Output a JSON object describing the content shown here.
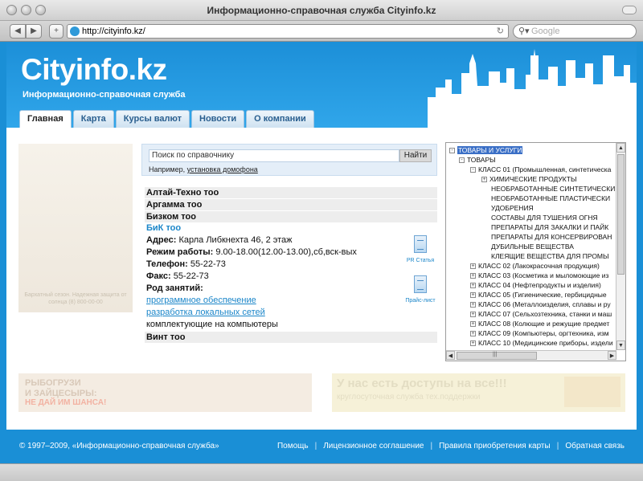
{
  "browser": {
    "title": "Информационно-справочная служба Cityinfo.kz",
    "url": "http://cityinfo.kz/",
    "search_placeholder": "Google"
  },
  "site": {
    "logo": "Cityinfo.kz",
    "tagline": "Информационно-справочная служба",
    "tabs": [
      "Главная",
      "Карта",
      "Курсы валют",
      "Новости",
      "О компании"
    ]
  },
  "ad_left_caption": "Бархатный сезон. Надежная защита от солнца (8) 800-00-00",
  "search": {
    "value": "Поиск по справочнику",
    "button": "Найти",
    "hint_prefix": "Например,",
    "hint_link": "установка домофона"
  },
  "companies": {
    "c1": "Алтай-Техно тоо",
    "c2": "Аргамма тоо",
    "c3": "Бизком тоо",
    "c4": "БиК тоо",
    "c5": "Винт тоо"
  },
  "company_details": {
    "address_label": "Адрес:",
    "address": "Карла Либкнехта 46, 2 этаж",
    "hours_label": "Режим работы:",
    "hours": "9.00-18.00(12.00-13.00),сб,вск-вых",
    "phone_label": "Телефон:",
    "phone": "55-22-73",
    "fax_label": "Факс:",
    "fax": "55-22-73",
    "activities_label": "Род занятий:",
    "activities": [
      "программное обеспечение",
      "разработка локальных сетей"
    ],
    "activities_plain": "комплектующие на компьютеры",
    "pr_label": "PR Статья",
    "price_label": "Прайс-лист"
  },
  "tree": {
    "items": [
      {
        "label": "ТОВАРЫ И УСЛУГИ",
        "toggle": "-",
        "selected": true
      },
      {
        "label": "ТОВАРЫ",
        "toggle": "-"
      },
      {
        "label": "КЛАСС 01 (Промышленная, синтетическа",
        "toggle": "-"
      },
      {
        "label": "ХИМИЧЕСКИЕ ПРОДУКТЫ",
        "toggle": "+"
      },
      {
        "label": "НЕОБРАБОТАННЫЕ СИНТЕТИЧЕСКИ",
        "toggle": ""
      },
      {
        "label": "НЕОБРАБОТАННЫЕ ПЛАСТИЧЕСКИ",
        "toggle": ""
      },
      {
        "label": "УДОБРЕНИЯ",
        "toggle": ""
      },
      {
        "label": "СОСТАВЫ ДЛЯ ТУШЕНИЯ ОГНЯ",
        "toggle": ""
      },
      {
        "label": "ПРЕПАРАТЫ ДЛЯ ЗАКАЛКИ И ПАЙК",
        "toggle": ""
      },
      {
        "label": "ПРЕПАРАТЫ ДЛЯ КОНСЕРВИРОВАН",
        "toggle": ""
      },
      {
        "label": "ДУБИЛЬНЫЕ ВЕЩЕСТВА",
        "toggle": ""
      },
      {
        "label": "КЛЕЯЩИЕ ВЕЩЕСТВА ДЛЯ ПРОМЫ",
        "toggle": ""
      },
      {
        "label": "КЛАСС 02 (Лакокрасочная продукция)",
        "toggle": "+"
      },
      {
        "label": "КЛАСС 03 (Косметика и мыломоющие из",
        "toggle": "+"
      },
      {
        "label": "КЛАСС 04 (Нефтепродукты и изделия)",
        "toggle": "+"
      },
      {
        "label": "КЛАСС 05 (Гигиенические, гербицидные",
        "toggle": "+"
      },
      {
        "label": "КЛАСС 06 (Металлоизделия, сплавы и ру",
        "toggle": "+"
      },
      {
        "label": "КЛАСС 07 (Сельхозтехника, станки и маш",
        "toggle": "+"
      },
      {
        "label": "КЛАСС 08 (Колющие и режущие предмет",
        "toggle": "+"
      },
      {
        "label": "КЛАСС 09 (Компьютеры, оргтехника, изм",
        "toggle": "+"
      },
      {
        "label": "КЛАСС 10 (Медицинские приборы, издели",
        "toggle": "+"
      }
    ],
    "hscroll_grip": "|||"
  },
  "ads_bottom": {
    "left_line1": "РЫБОГРУЗИ",
    "left_line2": "И ЗАЙЦЕСЫРЫ:",
    "left_line3": "НЕ ДАЙ ИМ ШАНСА!",
    "right_line1": "У нас есть доступы на все!!!",
    "right_line2": "круглосуточная служба тех.поддержки"
  },
  "footer": {
    "copyright": "© 1997–2009, «Информационно-справочная служба»",
    "links": [
      "Помощь",
      "Лицензионное соглашение",
      "Правила приобретения карты",
      "Обратная связь"
    ]
  }
}
